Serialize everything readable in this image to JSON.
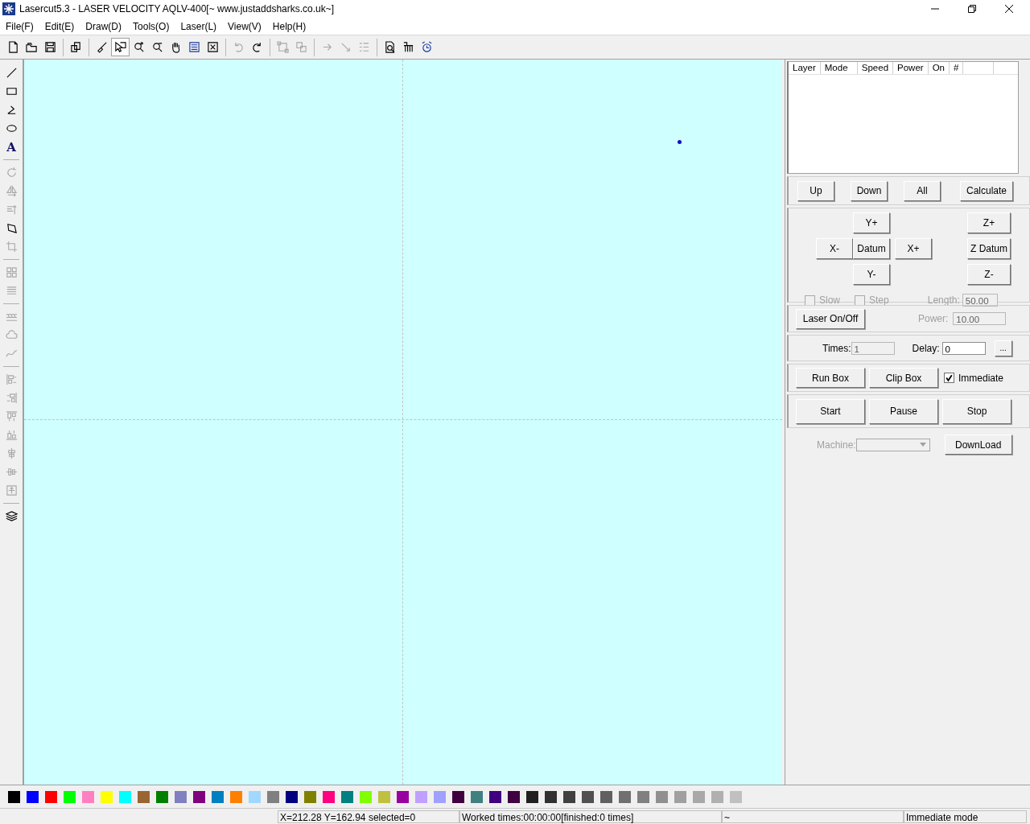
{
  "window": {
    "title": "Lasercut5.3 - LASER VELOCITY AQLV-400[~ www.justaddsharks.co.uk~]"
  },
  "menu": [
    {
      "label": "File(F)"
    },
    {
      "label": "Edit(E)"
    },
    {
      "label": "Draw(D)"
    },
    {
      "label": "Tools(O)"
    },
    {
      "label": "Laser(L)"
    },
    {
      "label": "View(V)"
    },
    {
      "label": "Help(H)"
    }
  ],
  "toolbar": [
    [
      {
        "kind": "new",
        "disabled": false,
        "pressed": false
      },
      {
        "kind": "open",
        "disabled": false,
        "pressed": false
      },
      {
        "kind": "save",
        "disabled": false,
        "pressed": false
      }
    ],
    [
      {
        "kind": "import",
        "disabled": false,
        "pressed": false
      }
    ],
    [
      {
        "kind": "brush",
        "disabled": false,
        "pressed": false
      },
      {
        "kind": "select",
        "disabled": false,
        "pressed": true
      },
      {
        "kind": "zoomin",
        "disabled": false,
        "pressed": false
      },
      {
        "kind": "zoomout",
        "disabled": false,
        "pressed": false
      },
      {
        "kind": "pan",
        "disabled": false,
        "pressed": false
      },
      {
        "kind": "page",
        "disabled": false,
        "pressed": false
      },
      {
        "kind": "fit",
        "disabled": false,
        "pressed": false
      }
    ],
    [
      {
        "kind": "undo",
        "disabled": true,
        "pressed": false
      },
      {
        "kind": "redo",
        "disabled": false,
        "pressed": false
      }
    ],
    [
      {
        "kind": "group",
        "disabled": true,
        "pressed": false
      },
      {
        "kind": "ungroup",
        "disabled": true,
        "pressed": false
      }
    ],
    [
      {
        "kind": "arrow",
        "disabled": true,
        "pressed": false
      },
      {
        "kind": "diagonal",
        "disabled": true,
        "pressed": false
      },
      {
        "kind": "list",
        "disabled": true,
        "pressed": false
      }
    ],
    [
      {
        "kind": "preview",
        "disabled": false,
        "pressed": false
      },
      {
        "kind": "ruler",
        "disabled": false,
        "pressed": false
      },
      {
        "kind": "clock",
        "disabled": false,
        "pressed": false
      }
    ]
  ],
  "left_toolbar": [
    [
      {
        "kind": "line",
        "disabled": false
      },
      {
        "kind": "rect",
        "disabled": false
      },
      {
        "kind": "polyline",
        "disabled": false
      },
      {
        "kind": "ellipse",
        "disabled": false
      },
      {
        "kind": "text",
        "disabled": false,
        "glyph": "A"
      }
    ],
    [
      {
        "kind": "rotate",
        "disabled": true
      },
      {
        "kind": "mirrorh",
        "disabled": true
      },
      {
        "kind": "mirrorv",
        "disabled": true
      },
      {
        "kind": "nodes",
        "disabled": false
      },
      {
        "kind": "crop",
        "disabled": true
      }
    ],
    [
      {
        "kind": "array",
        "disabled": true
      },
      {
        "kind": "lines",
        "disabled": true
      }
    ],
    [
      {
        "kind": "hatch",
        "disabled": true
      },
      {
        "kind": "cloud",
        "disabled": true
      },
      {
        "kind": "curve",
        "disabled": true
      }
    ],
    [
      {
        "kind": "alignleft",
        "disabled": true
      },
      {
        "kind": "alignright",
        "disabled": true
      },
      {
        "kind": "aligntop",
        "disabled": true
      },
      {
        "kind": "alignbottom",
        "disabled": true
      },
      {
        "kind": "centerh",
        "disabled": true
      },
      {
        "kind": "centerv",
        "disabled": true
      },
      {
        "kind": "centerpage",
        "disabled": true
      }
    ],
    [
      {
        "kind": "layers",
        "disabled": false
      }
    ]
  ],
  "layers_table": {
    "columns": [
      "Layer",
      "Mode",
      "Speed",
      "Power",
      "On",
      "#"
    ]
  },
  "layer_buttons": [
    "Up",
    "Down",
    "All",
    "Calculate"
  ],
  "jog": {
    "y_plus": "Y+",
    "x_minus": "X-",
    "datum": "Datum",
    "x_plus": "X+",
    "y_minus": "Y-",
    "z_plus": "Z+",
    "z_datum": "Z Datum",
    "z_minus": "Z-"
  },
  "jog_options": [
    {
      "label": "Slow",
      "checked": false,
      "disabled": true
    },
    {
      "label": "Step",
      "checked": false,
      "disabled": true
    }
  ],
  "length": {
    "label": "Length:",
    "value": "50.00",
    "disabled": true
  },
  "laser": {
    "button": "Laser On/Off",
    "power_label": "Power:",
    "power_value": "10.00",
    "disabled": true
  },
  "times": {
    "label": "Times:",
    "value": "1",
    "disabled": true
  },
  "delay": {
    "label": "Delay:",
    "value": "0",
    "disabled": false
  },
  "more_button": "...",
  "box_buttons": [
    "Run Box",
    "Clip Box"
  ],
  "immediate": {
    "label": "Immediate",
    "checked": true
  },
  "run_buttons": [
    "Start",
    "Pause",
    "Stop"
  ],
  "machine": {
    "label": "Machine:",
    "disabled": true
  },
  "download_button": "DownLoad",
  "palette": [
    {
      "color": "#000000"
    },
    {
      "color": "#0000ff"
    },
    {
      "color": "#ff0000"
    },
    {
      "color": "#00ff00"
    },
    {
      "color": "#ff80c0"
    },
    {
      "color": "#ffff00"
    },
    {
      "color": "#00ffff"
    },
    {
      "color": "#996633"
    },
    {
      "color": "#008000"
    },
    {
      "color": "#8080c0"
    },
    {
      "color": "#800080"
    },
    {
      "color": "#0080c0"
    },
    {
      "color": "#ff8000"
    },
    {
      "color": "#a0d8ff"
    },
    {
      "color": "#808080"
    },
    {
      "color": "#000080"
    },
    {
      "color": "#808000"
    },
    {
      "color": "#ff0080"
    },
    {
      "color": "#008080"
    },
    {
      "color": "#80ff00"
    },
    {
      "color": "#c0c040"
    },
    {
      "color": "#9900a0"
    },
    {
      "color": "#c0a0ff"
    },
    {
      "color": "#a0a0ff"
    },
    {
      "color": "#400040"
    },
    {
      "color": "#408080"
    },
    {
      "color": "#400080"
    },
    {
      "color": "#400041"
    },
    {
      "color": "#202020"
    },
    {
      "color": "#303030"
    },
    {
      "color": "#404040"
    },
    {
      "color": "#505050"
    },
    {
      "color": "#606060"
    },
    {
      "color": "#707070"
    },
    {
      "color": "#808081"
    },
    {
      "color": "#909090"
    },
    {
      "color": "#a0a0a0"
    },
    {
      "color": "#a8a8a8"
    },
    {
      "color": "#b0b0b0"
    },
    {
      "color": "#c0c0c0"
    }
  ],
  "status_bar": [
    "X=212.28 Y=162.94 selected=0",
    "Worked times:00:00:00[finished:0 times]",
    "~",
    "Immediate mode"
  ]
}
